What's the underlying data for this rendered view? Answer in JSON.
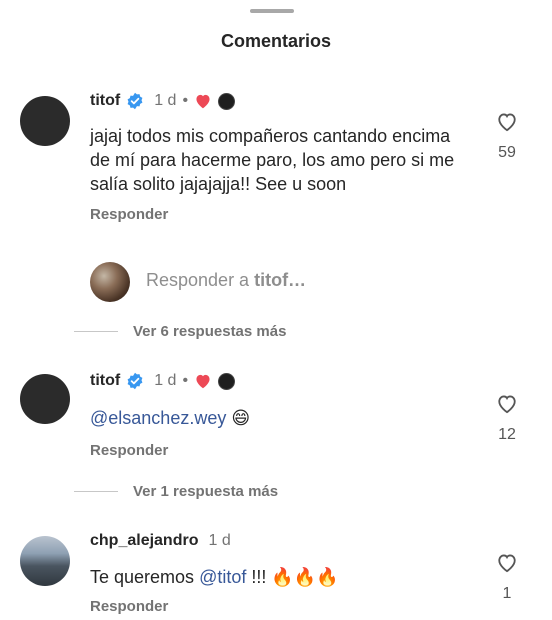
{
  "header": {
    "title": "Comentarios"
  },
  "comments": [
    {
      "username": "titof",
      "time": "1 d",
      "separator": "•",
      "text": "jajaj todos mis compañeros cantando encima de mí para hacerme paro, los amo pero si me salía solito jajajajja!! See u soon",
      "reply_label": "Responder",
      "likes": "59"
    },
    {
      "username": "titof",
      "time": "1 d",
      "separator": "•",
      "mention": "@elsanchez.wey",
      "emoji": "😄",
      "reply_label": "Responder",
      "likes": "12"
    },
    {
      "username": "chp_alejandro",
      "time": "1 d",
      "text_before": "Te queremos ",
      "mention": "@titof",
      "text_after": " !!! ",
      "emoji": "🔥🔥🔥",
      "reply_label": "Responder",
      "likes": "1"
    }
  ],
  "reply_input": {
    "prefix": "Responder a ",
    "target": "titof…"
  },
  "more_replies": [
    {
      "label": "Ver 6 respuestas más"
    },
    {
      "label": "Ver 1 respuesta más"
    }
  ],
  "colors": {
    "mention": "#385898",
    "verified": "#3897f0",
    "heart": "#ed4956"
  },
  "icons": [
    "verified-badge-icon",
    "red-heart-icon",
    "like-heart-icon"
  ]
}
